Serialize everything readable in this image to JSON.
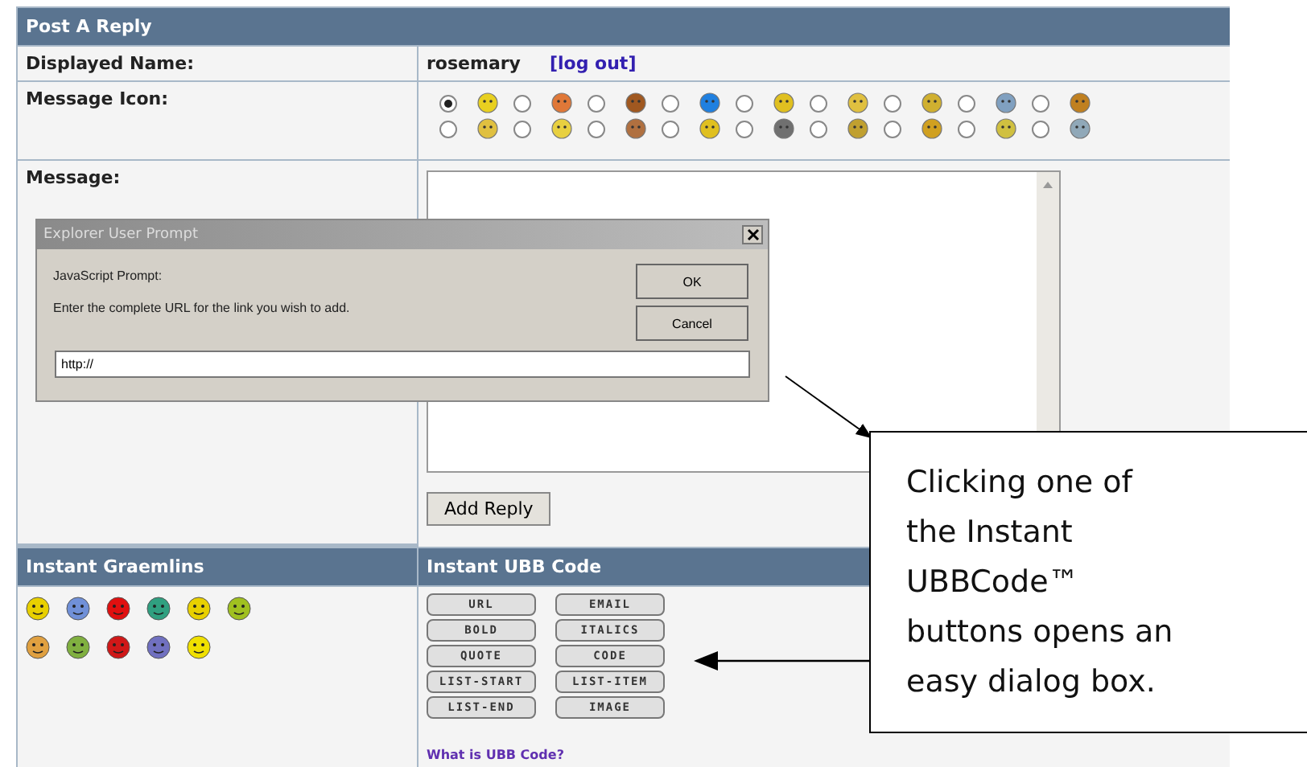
{
  "form": {
    "title": "Post A Reply",
    "name_label": "Displayed Name:",
    "name_value": "rosemary",
    "logout_link": "[log out]",
    "icon_label": "Message Icon:",
    "message_icons": [
      {
        "selected": true
      },
      {
        "selected": false
      },
      {
        "selected": false
      },
      {
        "selected": false
      },
      {
        "selected": false
      },
      {
        "selected": false
      },
      {
        "selected": false
      },
      {
        "selected": false
      },
      {
        "selected": false
      },
      {
        "selected": false
      },
      {
        "selected": false
      },
      {
        "selected": false
      },
      {
        "selected": false
      },
      {
        "selected": false
      },
      {
        "selected": false
      },
      {
        "selected": false
      },
      {
        "selected": false
      },
      {
        "selected": false
      }
    ],
    "message_label": "Message:",
    "submit_button": "Add Reply",
    "graemlins_title": "Instant Graemlins",
    "ubb_title": "Instant UBB Code",
    "ubb_buttons": [
      "URL",
      "EMAIL",
      "BOLD",
      "ITALICS",
      "QUOTE",
      "CODE",
      "LIST-START",
      "LIST-ITEM",
      "LIST-END",
      "IMAGE"
    ],
    "ubb_help_link": "What is UBB Code?"
  },
  "dialog": {
    "title": "Explorer User Prompt",
    "prompt_label": "JavaScript Prompt:",
    "message": "Enter the complete URL for the link you wish to add.",
    "value": "http://",
    "buttons": [
      "OK",
      "Cancel"
    ]
  },
  "callout": {
    "text": "Clicking one of\nthe Instant\nUBBCode™\nbuttons opens an\neasy dialog box."
  }
}
